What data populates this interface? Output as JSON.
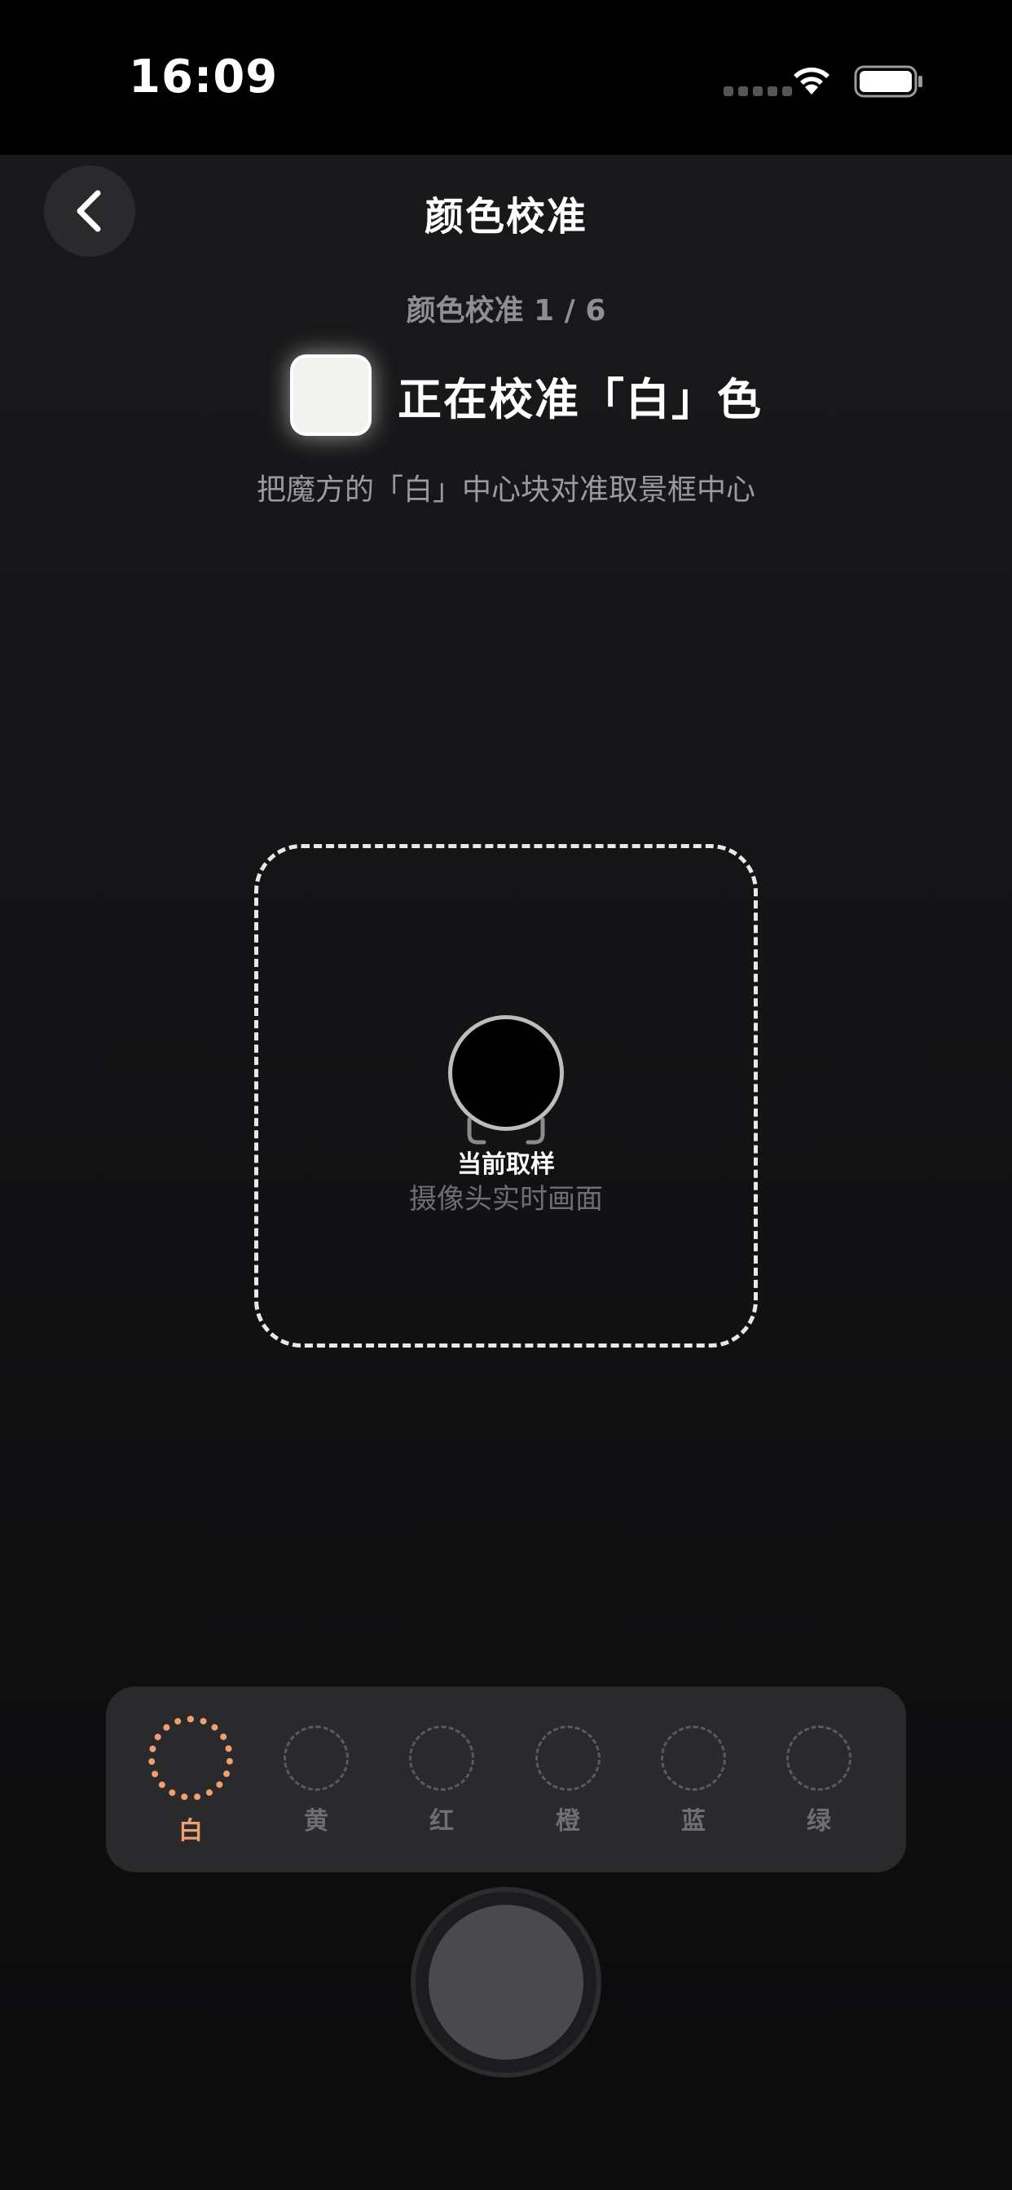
{
  "status_bar": {
    "time": "16:09",
    "icons": [
      "signal-dots-icon",
      "wifi-icon",
      "battery-icon"
    ]
  },
  "nav": {
    "back_icon": "chevron-left-icon",
    "title": "颜色校准"
  },
  "progress": {
    "label": "颜色校准 1 / 6"
  },
  "current_color": {
    "swatch_color": "#f2f2ee",
    "heading": "正在校准「白」色",
    "instruction": "把魔方的「白」中心块对准取景框中心"
  },
  "viewfinder": {
    "sample_color": "#000000",
    "sample_label": "当前取样",
    "sample_sub": "摄像头实时画面"
  },
  "color_selector": {
    "items": [
      {
        "label": "白",
        "active": true
      },
      {
        "label": "黄",
        "active": false
      },
      {
        "label": "红",
        "active": false
      },
      {
        "label": "橙",
        "active": false
      },
      {
        "label": "蓝",
        "active": false
      },
      {
        "label": "绿",
        "active": false
      }
    ],
    "accent_color": "#f0a070"
  },
  "shutter": {
    "icon": "capture-button"
  }
}
